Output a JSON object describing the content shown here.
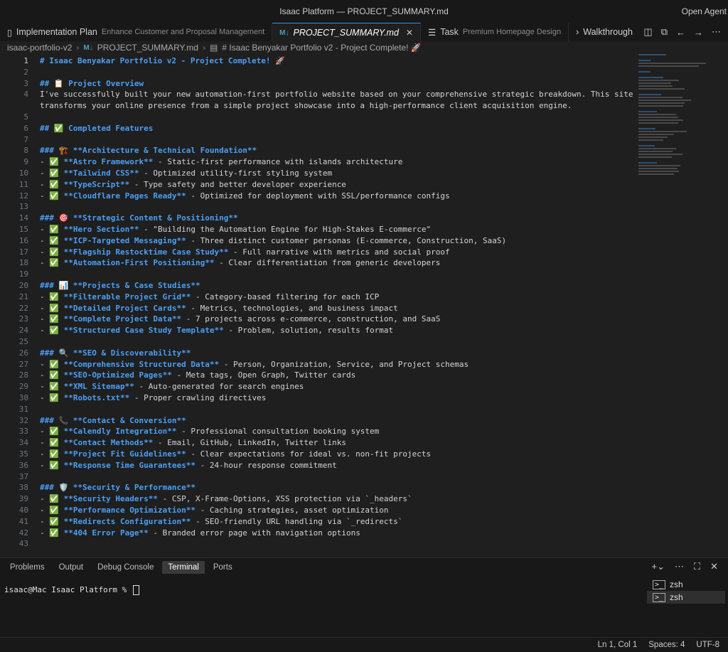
{
  "window": {
    "title": "Isaac Platform — PROJECT_SUMMARY.md",
    "right_label": "Open Agent"
  },
  "tabs": [
    {
      "label": "Implementation Plan",
      "desc": "Enhance Customer and Proposal Management",
      "active": false
    },
    {
      "label": "PROJECT_SUMMARY.md",
      "desc": "",
      "active": true
    },
    {
      "label": "Task",
      "desc": "Premium Homepage Design",
      "active": false
    },
    {
      "label": "Walkthrough",
      "desc": "",
      "active": false
    }
  ],
  "breadcrumb": {
    "root": "isaac-portfolio-v2",
    "file": "PROJECT_SUMMARY.md",
    "symbol": "# Isaac Benyakar Portfolio v2 - Project Complete! 🚀"
  },
  "editor": {
    "current_line": 1,
    "lines": [
      {
        "n": "1",
        "t": "# Isaac Benyakar Portfolio v2 - Project Complete! 🚀",
        "k": "h"
      },
      {
        "n": "2",
        "t": "",
        "k": ""
      },
      {
        "n": "3",
        "t": "## 📋 Project Overview",
        "k": "h"
      },
      {
        "n": "4",
        "t": "I've successfully built your new automation-first portfolio website based on your comprehensive strategic breakdown. This site",
        "k": ""
      },
      {
        "n": "",
        "t": "transforms your online presence from a simple project showcase into a high-performance client acquisition engine.",
        "k": ""
      },
      {
        "n": "5",
        "t": "",
        "k": ""
      },
      {
        "n": "6",
        "t": "## ✅ Completed Features",
        "k": "h"
      },
      {
        "n": "7",
        "t": "",
        "k": ""
      },
      {
        "n": "8",
        "t": "### 🏗️ **Architecture & Technical Foundation**",
        "k": "h"
      },
      {
        "n": "9",
        "t": "- ✅ **Astro Framework** - Static-first performance with islands architecture",
        "k": "b"
      },
      {
        "n": "10",
        "t": "- ✅ **Tailwind CSS** - Optimized utility-first styling system",
        "k": "b"
      },
      {
        "n": "11",
        "t": "- ✅ **TypeScript** - Type safety and better developer experience",
        "k": "b"
      },
      {
        "n": "12",
        "t": "- ✅ **Cloudflare Pages Ready** - Optimized for deployment with SSL/performance configs",
        "k": "b"
      },
      {
        "n": "13",
        "t": "",
        "k": ""
      },
      {
        "n": "14",
        "t": "### 🎯 **Strategic Content & Positioning**",
        "k": "h"
      },
      {
        "n": "15",
        "t": "- ✅ **Hero Section** - \"Building the Automation Engine for High-Stakes E-commerce\"",
        "k": "b"
      },
      {
        "n": "16",
        "t": "- ✅ **ICP-Targeted Messaging** - Three distinct customer personas (E-commerce, Construction, SaaS)",
        "k": "b"
      },
      {
        "n": "17",
        "t": "- ✅ **Flagship Restocktime Case Study** - Full narrative with metrics and social proof",
        "k": "b"
      },
      {
        "n": "18",
        "t": "- ✅ **Automation-First Positioning** - Clear differentiation from generic developers",
        "k": "b"
      },
      {
        "n": "19",
        "t": "",
        "k": ""
      },
      {
        "n": "20",
        "t": "### 📊 **Projects & Case Studies**",
        "k": "h"
      },
      {
        "n": "21",
        "t": "- ✅ **Filterable Project Grid** - Category-based filtering for each ICP",
        "k": "b"
      },
      {
        "n": "22",
        "t": "- ✅ **Detailed Project Cards** - Metrics, technologies, and business impact",
        "k": "b"
      },
      {
        "n": "23",
        "t": "- ✅ **Complete Project Data** - 7 projects across e-commerce, construction, and SaaS",
        "k": "b"
      },
      {
        "n": "24",
        "t": "- ✅ **Structured Case Study Template** - Problem, solution, results format",
        "k": "b"
      },
      {
        "n": "25",
        "t": "",
        "k": ""
      },
      {
        "n": "26",
        "t": "### 🔍 **SEO & Discoverability**",
        "k": "h"
      },
      {
        "n": "27",
        "t": "- ✅ **Comprehensive Structured Data** - Person, Organization, Service, and Project schemas",
        "k": "b"
      },
      {
        "n": "28",
        "t": "- ✅ **SEO-Optimized Pages** - Meta tags, Open Graph, Twitter cards",
        "k": "b"
      },
      {
        "n": "29",
        "t": "- ✅ **XML Sitemap** - Auto-generated for search engines",
        "k": "b"
      },
      {
        "n": "30",
        "t": "- ✅ **Robots.txt** - Proper crawling directives",
        "k": "b"
      },
      {
        "n": "31",
        "t": "",
        "k": ""
      },
      {
        "n": "32",
        "t": "### 📞 **Contact & Conversion**",
        "k": "h"
      },
      {
        "n": "33",
        "t": "- ✅ **Calendly Integration** - Professional consultation booking system",
        "k": "b"
      },
      {
        "n": "34",
        "t": "- ✅ **Contact Methods** - Email, GitHub, LinkedIn, Twitter links",
        "k": "b"
      },
      {
        "n": "35",
        "t": "- ✅ **Project Fit Guidelines** - Clear expectations for ideal vs. non-fit projects",
        "k": "b"
      },
      {
        "n": "36",
        "t": "- ✅ **Response Time Guarantees** - 24-hour response commitment",
        "k": "b"
      },
      {
        "n": "37",
        "t": "",
        "k": ""
      },
      {
        "n": "38",
        "t": "### 🛡️ **Security & Performance**",
        "k": "h"
      },
      {
        "n": "39",
        "t": "- ✅ **Security Headers** - CSP, X-Frame-Options, XSS protection via `_headers`",
        "k": "b"
      },
      {
        "n": "40",
        "t": "- ✅ **Performance Optimization** - Caching strategies, asset optimization",
        "k": "b"
      },
      {
        "n": "41",
        "t": "- ✅ **Redirects Configuration** - SEO-friendly URL handling via `_redirects`",
        "k": "b"
      },
      {
        "n": "42",
        "t": "- ✅ **404 Error Page** - Branded error page with navigation options",
        "k": "b"
      },
      {
        "n": "43",
        "t": "",
        "k": ""
      }
    ]
  },
  "panel": {
    "tabs": [
      "Problems",
      "Output",
      "Debug Console",
      "Terminal",
      "Ports"
    ],
    "active_tab": "Terminal",
    "prompt": "isaac@Mac Isaac Platform % ",
    "terminals": [
      "zsh",
      "zsh"
    ]
  },
  "status": {
    "position": "Ln 1, Col 1",
    "spaces": "Spaces: 4",
    "encoding": "UTF-8"
  }
}
